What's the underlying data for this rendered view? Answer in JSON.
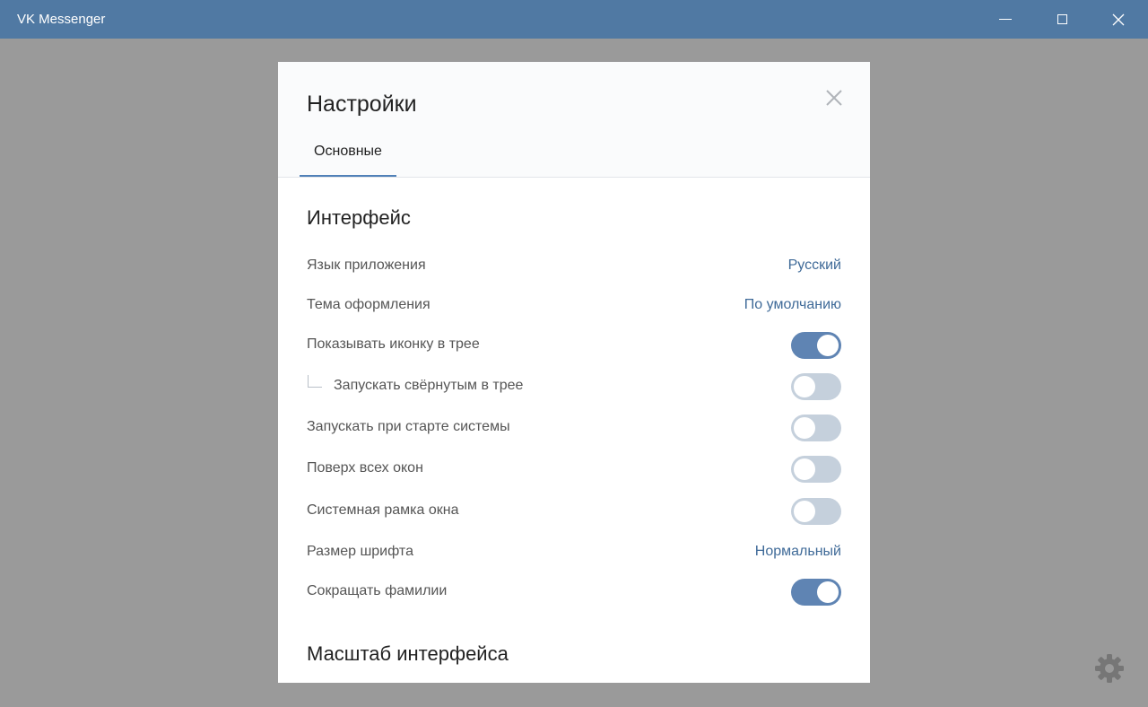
{
  "window": {
    "title": "VK Messenger",
    "colors": {
      "titlebar": "#5079a3",
      "overlay": "#9a9a9a"
    }
  },
  "settings": {
    "title": "Настройки",
    "tabs": [
      {
        "label": "Основные",
        "active": true
      }
    ],
    "sections": [
      {
        "title": "Интерфейс",
        "rows": [
          {
            "label": "Язык приложения",
            "type": "value",
            "value": "Русский"
          },
          {
            "label": "Тема оформления",
            "type": "value",
            "value": "По умолчанию"
          },
          {
            "label": "Показывать иконку в трее",
            "type": "toggle",
            "on": true
          },
          {
            "label": "Запускать свёрнутым в трее",
            "type": "toggle",
            "on": false,
            "nested": true
          },
          {
            "label": "Запускать при старте системы",
            "type": "toggle",
            "on": false
          },
          {
            "label": "Поверх всех окон",
            "type": "toggle",
            "on": false
          },
          {
            "label": "Системная рамка окна",
            "type": "toggle",
            "on": false
          },
          {
            "label": "Размер шрифта",
            "type": "value",
            "value": "Нормальный"
          },
          {
            "label": "Сокращать фамилии",
            "type": "toggle",
            "on": true
          }
        ]
      },
      {
        "title": "Масштаб интерфейса",
        "rows": []
      }
    ],
    "colors": {
      "accent": "#5181b8",
      "link": "#3f6a98",
      "toggle_on": "#5f84b3",
      "toggle_off": "#c5d0dc"
    }
  },
  "icons": {
    "close": "close-icon",
    "gear": "gear-icon",
    "minimize": "minimize-icon",
    "maximize": "maximize-icon"
  }
}
